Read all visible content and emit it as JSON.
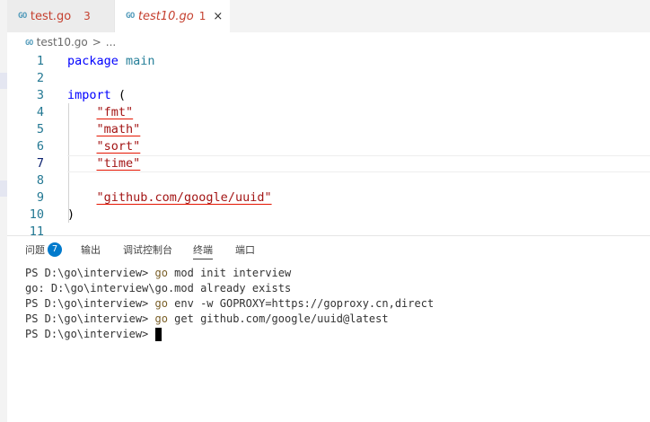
{
  "tabs": [
    {
      "name": "test.go",
      "problem_count": "3",
      "icon": "go-file-icon"
    },
    {
      "name": "test10.go",
      "problem_count": "1",
      "icon": "go-file-icon",
      "close": "×"
    }
  ],
  "breadcrumb": {
    "file": "test10.go",
    "separator": ">",
    "more": "..."
  },
  "icon_glyph": "GO",
  "editor": {
    "lines": [
      {
        "n": "1",
        "tokens": [
          {
            "t": "package",
            "c": "kw"
          },
          {
            "t": " ",
            "c": "plain"
          },
          {
            "t": "main",
            "c": "pkg"
          }
        ]
      },
      {
        "n": "2",
        "tokens": []
      },
      {
        "n": "3",
        "tokens": [
          {
            "t": "import",
            "c": "kw"
          },
          {
            "t": " (",
            "c": "plain"
          }
        ]
      },
      {
        "n": "4",
        "tokens": [
          {
            "t": "    ",
            "c": "plain"
          },
          {
            "t": "\"fmt\"",
            "c": "str"
          }
        ]
      },
      {
        "n": "5",
        "tokens": [
          {
            "t": "    ",
            "c": "plain"
          },
          {
            "t": "\"math\"",
            "c": "str"
          }
        ]
      },
      {
        "n": "6",
        "tokens": [
          {
            "t": "    ",
            "c": "plain"
          },
          {
            "t": "\"sort\"",
            "c": "str"
          }
        ]
      },
      {
        "n": "7",
        "tokens": [
          {
            "t": "    ",
            "c": "plain"
          },
          {
            "t": "\"time\"",
            "c": "str"
          }
        ],
        "current": true
      },
      {
        "n": "8",
        "tokens": []
      },
      {
        "n": "9",
        "tokens": [
          {
            "t": "    ",
            "c": "plain"
          },
          {
            "t": "\"github.com/google/uuid\"",
            "c": "str"
          }
        ]
      },
      {
        "n": "10",
        "tokens": [
          {
            "t": ")",
            "c": "plain"
          }
        ]
      },
      {
        "n": "11",
        "tokens": []
      }
    ]
  },
  "panel": {
    "tabs": [
      "问题",
      "输出",
      "调试控制台",
      "终端",
      "端口"
    ],
    "problems_badge": "7",
    "active_tab": "终端"
  },
  "terminal": {
    "lines": [
      {
        "prompt": "PS D:\\go\\interview> ",
        "cmd": "go",
        "rest": " mod init interview"
      },
      {
        "prompt": "go: D:\\go\\interview\\go.mod already exists",
        "cmd": "",
        "rest": ""
      },
      {
        "prompt": "PS D:\\go\\interview> ",
        "cmd": "go",
        "rest": " env -w GOPROXY=https://goproxy.cn,direct"
      },
      {
        "prompt": "PS D:\\go\\interview> ",
        "cmd": "go",
        "rest": " get github.com/google/uuid@latest"
      },
      {
        "prompt": "PS D:\\go\\interview> ",
        "cmd": "",
        "rest": "",
        "cursor": true
      }
    ]
  },
  "colors": {
    "keyword": "#0000ff",
    "package": "#267f99",
    "string": "#a31515",
    "error_tab": "#c5402f",
    "line_number": "#237893",
    "badge": "#007acc",
    "command": "#795e26"
  }
}
